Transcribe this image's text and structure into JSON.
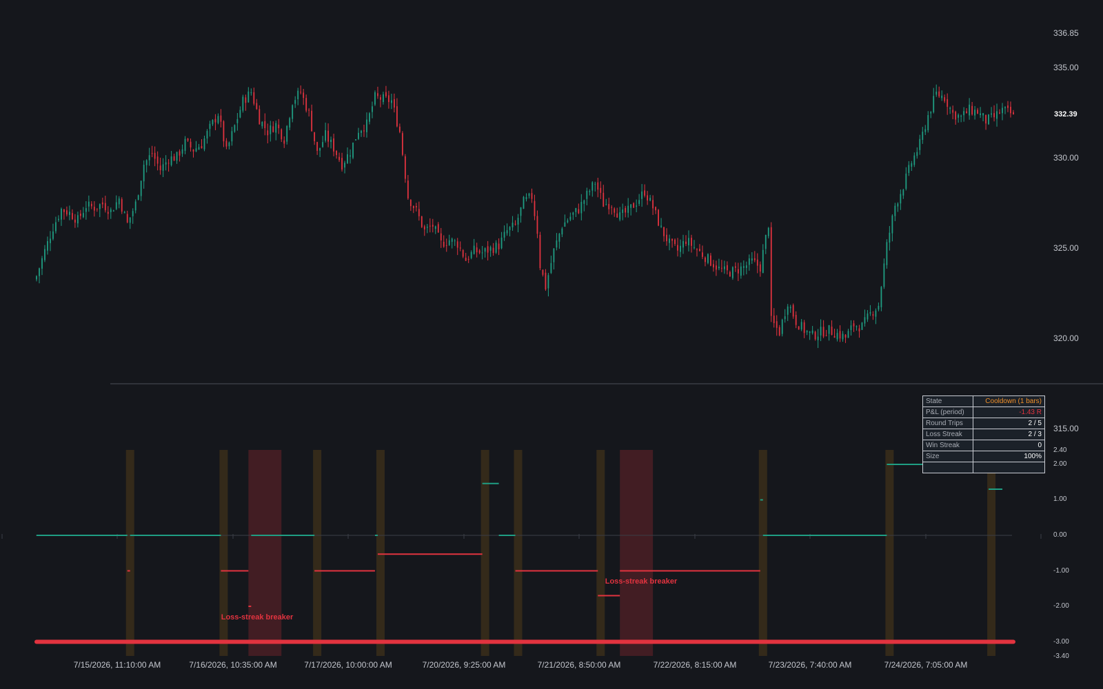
{
  "price_axis": {
    "ticks": [
      "336.85",
      "335.00",
      "330.00",
      "325.00",
      "320.00",
      "315.00"
    ],
    "last_price": "332.39"
  },
  "pnl_axis": {
    "ticks": [
      "2.40",
      "2.00",
      "1.00",
      "0.00",
      "-1.00",
      "-2.00",
      "-3.00",
      "-3.40"
    ]
  },
  "time_axis": {
    "labels": [
      "7/15/2026, 11:10:00 AM",
      "7/16/2026, 10:35:00 AM",
      "7/17/2026, 10:00:00 AM",
      "7/20/2026, 9:25:00 AM",
      "7/21/2026, 8:50:00 AM",
      "7/22/2026, 8:15:00 AM",
      "7/23/2026, 7:40:00 AM",
      "7/24/2026, 7:05:00 AM"
    ]
  },
  "annotations": [
    "Loss-streak breaker",
    "Loss-streak breaker"
  ],
  "status_table": {
    "rows": [
      {
        "key": "State",
        "value": "Cooldown (1 bars)"
      },
      {
        "key": "P&L (period)",
        "value": "-1.43 R"
      },
      {
        "key": "Round Trips",
        "value": "2 / 5"
      },
      {
        "key": "Loss Streak",
        "value": "2 / 3"
      },
      {
        "key": "Win Streak",
        "value": "0"
      },
      {
        "key": "Size",
        "value": "100%"
      },
      {
        "key": "",
        "value": ""
      }
    ]
  },
  "colors": {
    "background": "#15171c",
    "up": "#1f9e83",
    "down": "#e2333f",
    "cooldown_band": "#3a2e1a",
    "breaker_band": "#4a1f24",
    "state_text": "#f0902a",
    "separator": "#4b4f57"
  },
  "chart_data": [
    {
      "type": "candlestick",
      "ylim": [
        315,
        336.85
      ],
      "last_value": 332.39,
      "x": [
        "7/15/2026, 11:10:00 AM",
        "7/16/2026, 10:35:00 AM",
        "7/17/2026, 10:00:00 AM",
        "7/20/2026, 9:25:00 AM",
        "7/21/2026, 8:50:00 AM",
        "7/22/2026, 8:15:00 AM",
        "7/23/2026, 7:40:00 AM",
        "7/24/2026, 7:05:00 AM"
      ],
      "close_path": [
        [
          0,
          323.6
        ],
        [
          3,
          325.0
        ],
        [
          6,
          326.3
        ],
        [
          9,
          327.3
        ],
        [
          12,
          327.1
        ],
        [
          15,
          326.7
        ],
        [
          18,
          327.5
        ],
        [
          21,
          327.4
        ],
        [
          24,
          327.6
        ],
        [
          27,
          327.2
        ],
        [
          30,
          327.9
        ],
        [
          33,
          326.5
        ],
        [
          36,
          327.6
        ],
        [
          39,
          329.8
        ],
        [
          42,
          330.4
        ],
        [
          45,
          329.5
        ],
        [
          48,
          330.1
        ],
        [
          51,
          330.2
        ],
        [
          54,
          331.0
        ],
        [
          57,
          330.6
        ],
        [
          60,
          330.9
        ],
        [
          63,
          331.8
        ],
        [
          66,
          332.6
        ],
        [
          69,
          330.5
        ],
        [
          72,
          331.9
        ],
        [
          75,
          333.3
        ],
        [
          78,
          333.8
        ],
        [
          81,
          332.3
        ],
        [
          84,
          331.6
        ],
        [
          87,
          332.0
        ],
        [
          90,
          331.2
        ],
        [
          93,
          333.3
        ],
        [
          96,
          333.8
        ],
        [
          99,
          332.6
        ],
        [
          102,
          330.4
        ],
        [
          105,
          331.4
        ],
        [
          108,
          330.7
        ],
        [
          111,
          329.8
        ],
        [
          114,
          330.5
        ],
        [
          117,
          331.7
        ],
        [
          120,
          332.0
        ],
        [
          123,
          333.5
        ],
        [
          126,
          333.4
        ],
        [
          129,
          333.3
        ],
        [
          132,
          331.6
        ],
        [
          135,
          328.0
        ],
        [
          138,
          327.2
        ],
        [
          141,
          326.1
        ],
        [
          144,
          326.4
        ],
        [
          147,
          325.4
        ],
        [
          150,
          325.6
        ],
        [
          153,
          325.4
        ],
        [
          156,
          324.5
        ],
        [
          159,
          325.0
        ],
        [
          162,
          324.9
        ],
        [
          165,
          325.1
        ],
        [
          168,
          325.3
        ],
        [
          171,
          326.1
        ],
        [
          174,
          326.4
        ],
        [
          177,
          327.7
        ],
        [
          180,
          328.0
        ],
        [
          182,
          326.1
        ],
        [
          183,
          324.2
        ],
        [
          185,
          323.0
        ],
        [
          188,
          325.0
        ],
        [
          191,
          326.4
        ],
        [
          194,
          326.9
        ],
        [
          197,
          327.3
        ],
        [
          200,
          328.1
        ],
        [
          203,
          328.8
        ],
        [
          206,
          327.6
        ],
        [
          209,
          327.6
        ],
        [
          212,
          326.9
        ],
        [
          215,
          327.2
        ],
        [
          218,
          327.7
        ],
        [
          221,
          328.3
        ],
        [
          224,
          327.4
        ],
        [
          227,
          326.2
        ],
        [
          230,
          325.4
        ],
        [
          233,
          325.0
        ],
        [
          236,
          325.6
        ],
        [
          239,
          325.2
        ],
        [
          242,
          324.8
        ],
        [
          245,
          324.4
        ],
        [
          248,
          324.0
        ],
        [
          251,
          323.8
        ],
        [
          254,
          323.9
        ],
        [
          257,
          324.1
        ],
        [
          260,
          324.4
        ],
        [
          263,
          324.1
        ],
        [
          266,
          326.5
        ],
        [
          267,
          321.1
        ],
        [
          270,
          320.5
        ],
        [
          273,
          322.2
        ],
        [
          276,
          321.1
        ],
        [
          279,
          320.6
        ],
        [
          282,
          320.3
        ],
        [
          285,
          320.5
        ],
        [
          288,
          320.6
        ],
        [
          291,
          320.4
        ],
        [
          294,
          320.2
        ],
        [
          297,
          320.9
        ],
        [
          300,
          320.8
        ],
        [
          303,
          321.5
        ],
        [
          306,
          322.0
        ],
        [
          309,
          325.3
        ],
        [
          312,
          327.5
        ],
        [
          315,
          328.6
        ],
        [
          318,
          329.9
        ],
        [
          321,
          330.9
        ],
        [
          324,
          332.5
        ],
        [
          327,
          333.7
        ],
        [
          330,
          333.5
        ],
        [
          333,
          332.6
        ],
        [
          336,
          332.4
        ],
        [
          339,
          332.8
        ],
        [
          342,
          332.7
        ],
        [
          345,
          332.2
        ],
        [
          348,
          332.4
        ],
        [
          351,
          332.8
        ],
        [
          354,
          332.6
        ],
        [
          355,
          332.39
        ]
      ]
    },
    {
      "type": "step",
      "ylim": [
        -3.4,
        2.4
      ],
      "segments": [
        {
          "x": [
            0,
            33
          ],
          "value": 0.0
        },
        {
          "x": [
            33,
            34
          ],
          "value": -1.0
        },
        {
          "x": [
            34,
            67
          ],
          "value": 0.0
        },
        {
          "x": [
            67,
            77
          ],
          "value": -1.0
        },
        {
          "x": [
            77,
            78
          ],
          "value": -2.0
        },
        {
          "x": [
            78,
            101
          ],
          "value": 0.0
        },
        {
          "x": [
            101,
            123
          ],
          "value": -1.0
        },
        {
          "x": [
            123,
            124
          ],
          "value": 0.0
        },
        {
          "x": [
            124,
            162
          ],
          "value": -0.53
        },
        {
          "x": [
            162,
            168
          ],
          "value": 1.46
        },
        {
          "x": [
            168,
            174
          ],
          "value": 0.0
        },
        {
          "x": [
            174,
            204
          ],
          "value": -1.0
        },
        {
          "x": [
            204,
            212
          ],
          "value": -1.7
        },
        {
          "x": [
            212,
            263
          ],
          "value": -1.0
        },
        {
          "x": [
            263,
            264
          ],
          "value": 1.0
        },
        {
          "x": [
            264,
            309
          ],
          "value": 0.0
        },
        {
          "x": [
            309,
            346
          ],
          "value": 2.0
        },
        {
          "x": [
            346,
            351
          ],
          "value": 1.3
        }
      ],
      "hlines": [
        {
          "value": -3.0,
          "label": ""
        }
      ],
      "cooldown_bands": [
        [
          33,
          36
        ],
        [
          67,
          70
        ],
        [
          101,
          104
        ],
        [
          124,
          127
        ],
        [
          162,
          165
        ],
        [
          174,
          177
        ],
        [
          204,
          207
        ],
        [
          263,
          266
        ],
        [
          309,
          312
        ],
        [
          346,
          349
        ]
      ],
      "breaker_bands": [
        [
          77,
          89
        ],
        [
          212,
          224
        ]
      ],
      "annotations": [
        {
          "x": 77,
          "value": -2.35,
          "text": "Loss-streak breaker"
        },
        {
          "x": 212,
          "value": -1.35,
          "text": "Loss-streak breaker"
        }
      ]
    }
  ]
}
